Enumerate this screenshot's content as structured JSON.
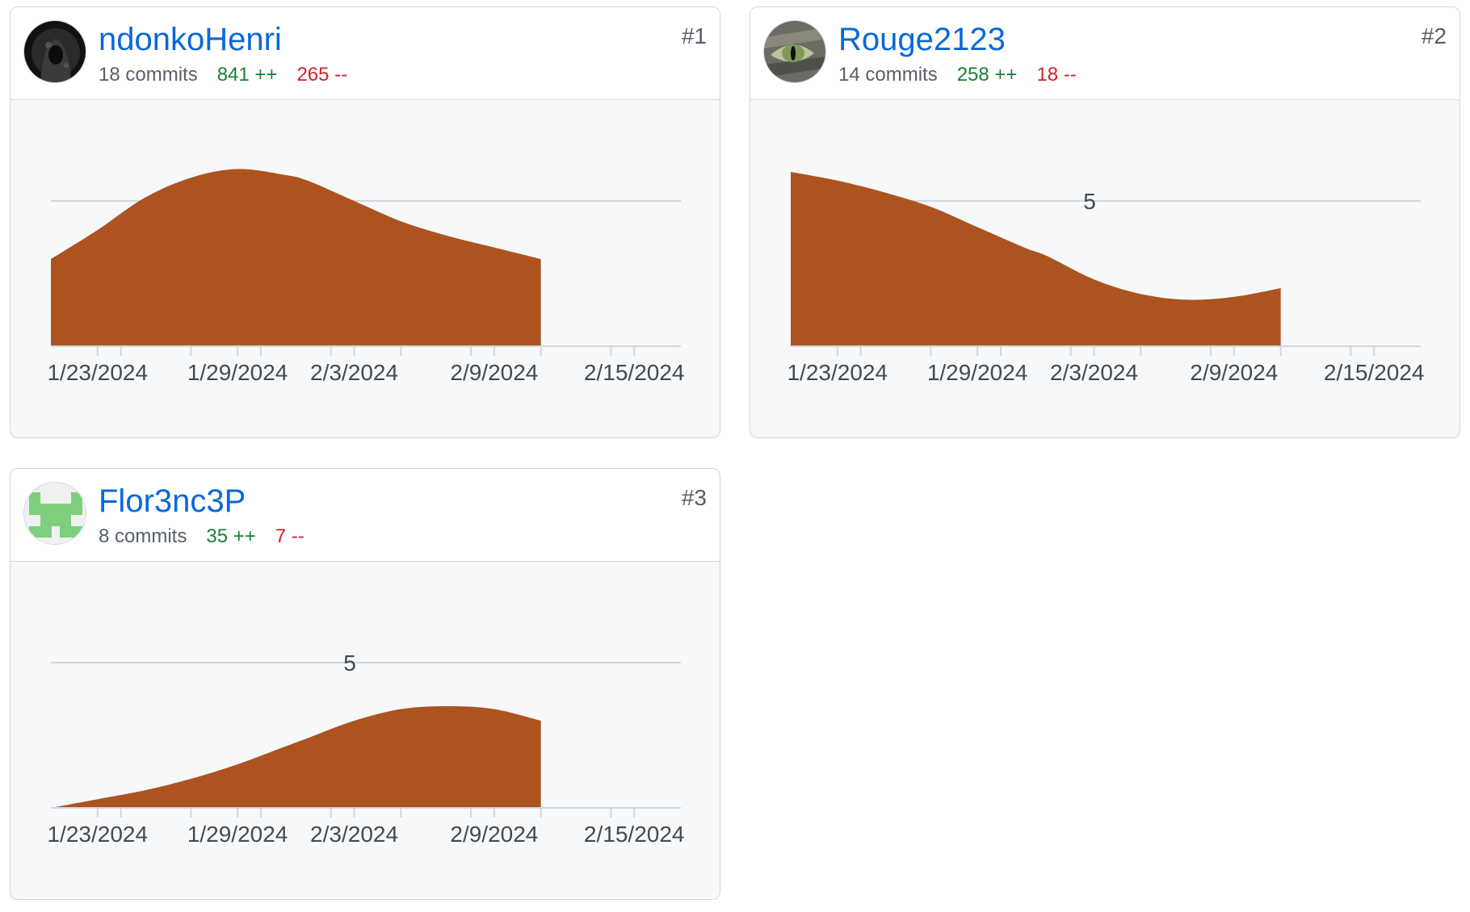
{
  "contributors": [
    {
      "rank": "#1",
      "login": "ndonkoHenri",
      "commits": "18 commits",
      "additions": "841 ++",
      "deletions": "265 --",
      "avatar_icon": "hooded-figure-avatar-icon"
    },
    {
      "rank": "#2",
      "login": "Rouge2123",
      "commits": "14 commits",
      "additions": "258 ++",
      "deletions": "18 --",
      "avatar_icon": "cat-eye-avatar-icon"
    },
    {
      "rank": "#3",
      "login": "Flor3nc3P",
      "commits": "8 commits",
      "additions": "35 ++",
      "deletions": "7 --",
      "avatar_icon": "identicon-avatar-icon"
    }
  ],
  "colors": {
    "area_fill": "#ad5320",
    "link": "#0969da",
    "additions": "#1a7f37",
    "deletions": "#cf222e",
    "muted": "#57606a",
    "border": "#d0d7de"
  },
  "chart_data": [
    {
      "type": "area",
      "x_tick_labels": [
        "1/23/2024",
        "1/29/2024",
        "2/3/2024",
        "2/9/2024",
        "2/15/2024"
      ],
      "x": [
        "2024-01-21",
        "2024-01-23",
        "2024-01-25",
        "2024-01-27",
        "2024-01-29",
        "2024-01-31",
        "2024-02-01",
        "2024-02-03",
        "2024-02-05",
        "2024-02-07",
        "2024-02-09",
        "2024-02-11"
      ],
      "values": [
        3,
        4,
        5.1,
        5.8,
        6.1,
        5.9,
        5.7,
        5,
        4.3,
        3.8,
        3.4,
        3
      ],
      "ylim": [
        0,
        8.5
      ],
      "gridlines": [
        5
      ],
      "grid_labels": [
        ""
      ],
      "xlim": [
        "2024-01-21",
        "2024-02-17"
      ]
    },
    {
      "type": "area",
      "x_tick_labels": [
        "1/23/2024",
        "1/29/2024",
        "2/3/2024",
        "2/9/2024",
        "2/15/2024"
      ],
      "x": [
        "2024-01-21",
        "2024-01-23",
        "2024-01-25",
        "2024-01-27",
        "2024-01-29",
        "2024-01-31",
        "2024-02-01",
        "2024-02-03",
        "2024-02-05",
        "2024-02-07",
        "2024-02-09",
        "2024-02-11"
      ],
      "values": [
        6,
        5.7,
        5.3,
        4.8,
        4.1,
        3.4,
        3.1,
        2.3,
        1.8,
        1.6,
        1.7,
        2
      ],
      "ylim": [
        0,
        8.5
      ],
      "gridlines": [
        5
      ],
      "grid_labels": [
        "5"
      ],
      "xlim": [
        "2024-01-21",
        "2024-02-17"
      ]
    },
    {
      "type": "area",
      "x_tick_labels": [
        "1/23/2024",
        "1/29/2024",
        "2/3/2024",
        "2/9/2024",
        "2/15/2024"
      ],
      "x": [
        "2024-01-21",
        "2024-01-23",
        "2024-01-25",
        "2024-01-27",
        "2024-01-29",
        "2024-01-31",
        "2024-02-01",
        "2024-02-03",
        "2024-02-05",
        "2024-02-07",
        "2024-02-09",
        "2024-02-11"
      ],
      "values": [
        0,
        0.3,
        0.6,
        1,
        1.5,
        2.1,
        2.4,
        3,
        3.4,
        3.5,
        3.4,
        3
      ],
      "ylim": [
        0,
        8.5
      ],
      "gridlines": [
        5
      ],
      "grid_labels": [
        "5"
      ],
      "xlim": [
        "2024-01-21",
        "2024-02-17"
      ]
    }
  ]
}
